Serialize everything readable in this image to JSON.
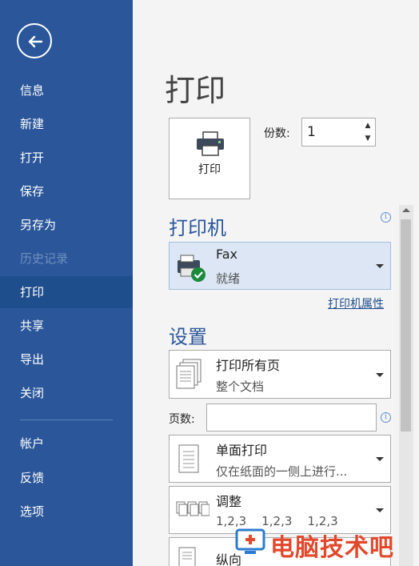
{
  "sidebar": {
    "items": [
      {
        "label": "信息"
      },
      {
        "label": "新建"
      },
      {
        "label": "打开"
      },
      {
        "label": "保存"
      },
      {
        "label": "另存为"
      },
      {
        "label": "历史记录"
      },
      {
        "label": "打印"
      },
      {
        "label": "共享"
      },
      {
        "label": "导出"
      },
      {
        "label": "关闭"
      },
      {
        "label": "帐户"
      },
      {
        "label": "反馈"
      },
      {
        "label": "选项"
      }
    ],
    "active": "打印",
    "disabled": [
      "历史记录"
    ]
  },
  "main": {
    "title": "打印",
    "print_button_label": "打印",
    "copies_label": "份数:",
    "copies_value": "1",
    "printer_section": "打印机",
    "printer": {
      "name": "Fax",
      "status": "就绪"
    },
    "printer_properties_link": "打印机属性",
    "settings_section": "设置",
    "settings": [
      {
        "line1": "打印所有页",
        "line2": "整个文档"
      },
      {
        "line1": "单面打印",
        "line2": "仅在纸面的一侧上进行..."
      },
      {
        "line1": "调整",
        "line2": "1,2,3    1,2,3    1,2,3"
      },
      {
        "line1": "纵向",
        "line2": ""
      }
    ],
    "pages_label": "页数:",
    "pages_value": ""
  },
  "watermark": {
    "text": "电脑技术吧"
  },
  "colors": {
    "sidebar": "#2b579a",
    "sidebar_active": "#1e4e8c",
    "accent": "#2b579a",
    "watermark": "#e2482c"
  },
  "icons": [
    "back-arrow-icon",
    "printer-icon",
    "fax-printer-icon",
    "check-icon",
    "info-icon",
    "pages-icon",
    "single-sided-icon",
    "collate-icon",
    "portrait-icon",
    "chevron-down-icon"
  ]
}
